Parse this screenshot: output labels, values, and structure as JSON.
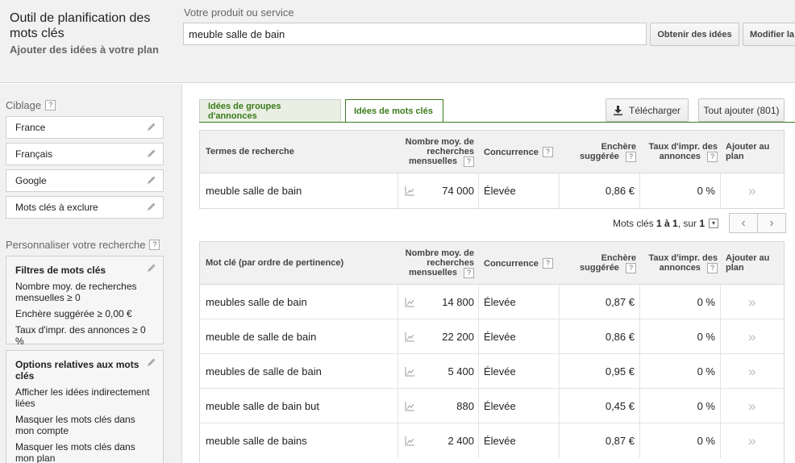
{
  "header": {
    "app_title": "Outil de planification des mots clés",
    "app_subtitle": "Ajouter des idées à votre plan",
    "product_label": "Votre produit ou service",
    "product_value": "meuble salle de bain",
    "get_ideas_label": "Obtenir des idées",
    "modify_label": "Modifier la"
  },
  "sidebar": {
    "targeting_label": "Ciblage",
    "targeting_items": [
      "France",
      "Français",
      "Google",
      "Mots clés à exclure"
    ],
    "customize_label": "Personnaliser votre recherche",
    "filters": {
      "title": "Filtres de mots clés",
      "lines": [
        "Nombre moy. de recherches mensuelles ≥ 0",
        "Enchère suggérée ≥ 0,00 €",
        "Taux d'impr. des annonces ≥ 0 %"
      ]
    },
    "options": {
      "title": "Options relatives aux mots clés",
      "lines": [
        "Afficher les idées indirectement liées",
        "Masquer les mots clés dans mon compte",
        "Masquer les mots clés dans mon plan"
      ]
    }
  },
  "tabs": {
    "groups_label": "Idées de groupes d'annonces",
    "keywords_label": "Idées de mots clés"
  },
  "toolbar": {
    "download_label": "Télécharger",
    "add_all_label": "Tout ajouter (801)"
  },
  "columns": {
    "search_terms": "Termes de recherche",
    "keyword_relevance": "Mot clé (par ordre de pertinence)",
    "avg_searches": "Nombre moy. de recherches mensuelles",
    "competition": "Concurrence",
    "suggested_bid": "Enchère suggérée",
    "impr_share": "Taux d'impr. des annonces",
    "add_to_plan": "Ajouter au plan"
  },
  "search_rows": [
    {
      "term": "meuble salle de bain",
      "searches": "74 000",
      "competition": "Élevée",
      "bid": "0,86 €",
      "impr": "0 %"
    }
  ],
  "pager": {
    "prefix": "Mots clés ",
    "range": "1 à 1",
    "sep": ", sur ",
    "total": "1"
  },
  "keyword_rows": [
    {
      "term": "meubles salle de bain",
      "searches": "14 800",
      "competition": "Élevée",
      "bid": "0,87 €",
      "impr": "0 %"
    },
    {
      "term": "meuble de salle de bain",
      "searches": "22 200",
      "competition": "Élevée",
      "bid": "0,86 €",
      "impr": "0 %"
    },
    {
      "term": "meubles de salle de bain",
      "searches": "5 400",
      "competition": "Élevée",
      "bid": "0,95 €",
      "impr": "0 %"
    },
    {
      "term": "meuble salle de bain but",
      "searches": "880",
      "competition": "Élevée",
      "bid": "0,45 €",
      "impr": "0 %"
    },
    {
      "term": "meuble salle de bains",
      "searches": "2 400",
      "competition": "Élevée",
      "bid": "0,87 €",
      "impr": "0 %"
    }
  ]
}
